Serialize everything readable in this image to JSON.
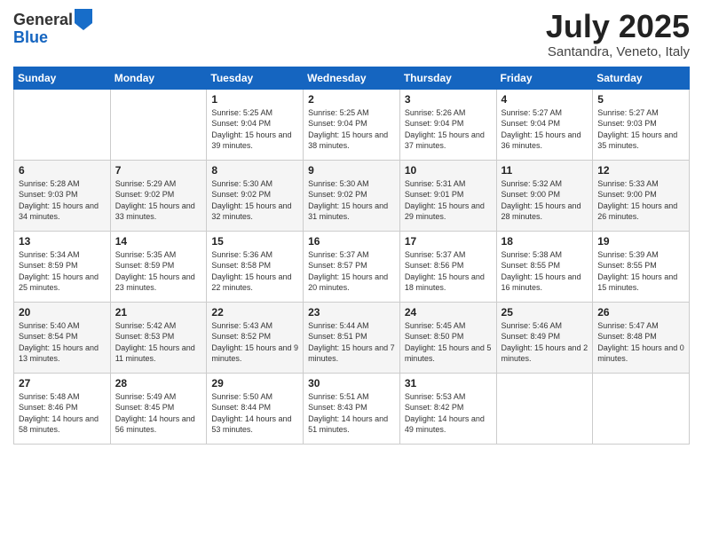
{
  "header": {
    "logo_general": "General",
    "logo_blue": "Blue",
    "month": "July 2025",
    "location": "Santandra, Veneto, Italy"
  },
  "days_of_week": [
    "Sunday",
    "Monday",
    "Tuesday",
    "Wednesday",
    "Thursday",
    "Friday",
    "Saturday"
  ],
  "weeks": [
    [
      {
        "day": "",
        "info": ""
      },
      {
        "day": "",
        "info": ""
      },
      {
        "day": "1",
        "info": "Sunrise: 5:25 AM\nSunset: 9:04 PM\nDaylight: 15 hours and 39 minutes."
      },
      {
        "day": "2",
        "info": "Sunrise: 5:25 AM\nSunset: 9:04 PM\nDaylight: 15 hours and 38 minutes."
      },
      {
        "day": "3",
        "info": "Sunrise: 5:26 AM\nSunset: 9:04 PM\nDaylight: 15 hours and 37 minutes."
      },
      {
        "day": "4",
        "info": "Sunrise: 5:27 AM\nSunset: 9:04 PM\nDaylight: 15 hours and 36 minutes."
      },
      {
        "day": "5",
        "info": "Sunrise: 5:27 AM\nSunset: 9:03 PM\nDaylight: 15 hours and 35 minutes."
      }
    ],
    [
      {
        "day": "6",
        "info": "Sunrise: 5:28 AM\nSunset: 9:03 PM\nDaylight: 15 hours and 34 minutes."
      },
      {
        "day": "7",
        "info": "Sunrise: 5:29 AM\nSunset: 9:02 PM\nDaylight: 15 hours and 33 minutes."
      },
      {
        "day": "8",
        "info": "Sunrise: 5:30 AM\nSunset: 9:02 PM\nDaylight: 15 hours and 32 minutes."
      },
      {
        "day": "9",
        "info": "Sunrise: 5:30 AM\nSunset: 9:02 PM\nDaylight: 15 hours and 31 minutes."
      },
      {
        "day": "10",
        "info": "Sunrise: 5:31 AM\nSunset: 9:01 PM\nDaylight: 15 hours and 29 minutes."
      },
      {
        "day": "11",
        "info": "Sunrise: 5:32 AM\nSunset: 9:00 PM\nDaylight: 15 hours and 28 minutes."
      },
      {
        "day": "12",
        "info": "Sunrise: 5:33 AM\nSunset: 9:00 PM\nDaylight: 15 hours and 26 minutes."
      }
    ],
    [
      {
        "day": "13",
        "info": "Sunrise: 5:34 AM\nSunset: 8:59 PM\nDaylight: 15 hours and 25 minutes."
      },
      {
        "day": "14",
        "info": "Sunrise: 5:35 AM\nSunset: 8:59 PM\nDaylight: 15 hours and 23 minutes."
      },
      {
        "day": "15",
        "info": "Sunrise: 5:36 AM\nSunset: 8:58 PM\nDaylight: 15 hours and 22 minutes."
      },
      {
        "day": "16",
        "info": "Sunrise: 5:37 AM\nSunset: 8:57 PM\nDaylight: 15 hours and 20 minutes."
      },
      {
        "day": "17",
        "info": "Sunrise: 5:37 AM\nSunset: 8:56 PM\nDaylight: 15 hours and 18 minutes."
      },
      {
        "day": "18",
        "info": "Sunrise: 5:38 AM\nSunset: 8:55 PM\nDaylight: 15 hours and 16 minutes."
      },
      {
        "day": "19",
        "info": "Sunrise: 5:39 AM\nSunset: 8:55 PM\nDaylight: 15 hours and 15 minutes."
      }
    ],
    [
      {
        "day": "20",
        "info": "Sunrise: 5:40 AM\nSunset: 8:54 PM\nDaylight: 15 hours and 13 minutes."
      },
      {
        "day": "21",
        "info": "Sunrise: 5:42 AM\nSunset: 8:53 PM\nDaylight: 15 hours and 11 minutes."
      },
      {
        "day": "22",
        "info": "Sunrise: 5:43 AM\nSunset: 8:52 PM\nDaylight: 15 hours and 9 minutes."
      },
      {
        "day": "23",
        "info": "Sunrise: 5:44 AM\nSunset: 8:51 PM\nDaylight: 15 hours and 7 minutes."
      },
      {
        "day": "24",
        "info": "Sunrise: 5:45 AM\nSunset: 8:50 PM\nDaylight: 15 hours and 5 minutes."
      },
      {
        "day": "25",
        "info": "Sunrise: 5:46 AM\nSunset: 8:49 PM\nDaylight: 15 hours and 2 minutes."
      },
      {
        "day": "26",
        "info": "Sunrise: 5:47 AM\nSunset: 8:48 PM\nDaylight: 15 hours and 0 minutes."
      }
    ],
    [
      {
        "day": "27",
        "info": "Sunrise: 5:48 AM\nSunset: 8:46 PM\nDaylight: 14 hours and 58 minutes."
      },
      {
        "day": "28",
        "info": "Sunrise: 5:49 AM\nSunset: 8:45 PM\nDaylight: 14 hours and 56 minutes."
      },
      {
        "day": "29",
        "info": "Sunrise: 5:50 AM\nSunset: 8:44 PM\nDaylight: 14 hours and 53 minutes."
      },
      {
        "day": "30",
        "info": "Sunrise: 5:51 AM\nSunset: 8:43 PM\nDaylight: 14 hours and 51 minutes."
      },
      {
        "day": "31",
        "info": "Sunrise: 5:53 AM\nSunset: 8:42 PM\nDaylight: 14 hours and 49 minutes."
      },
      {
        "day": "",
        "info": ""
      },
      {
        "day": "",
        "info": ""
      }
    ]
  ]
}
